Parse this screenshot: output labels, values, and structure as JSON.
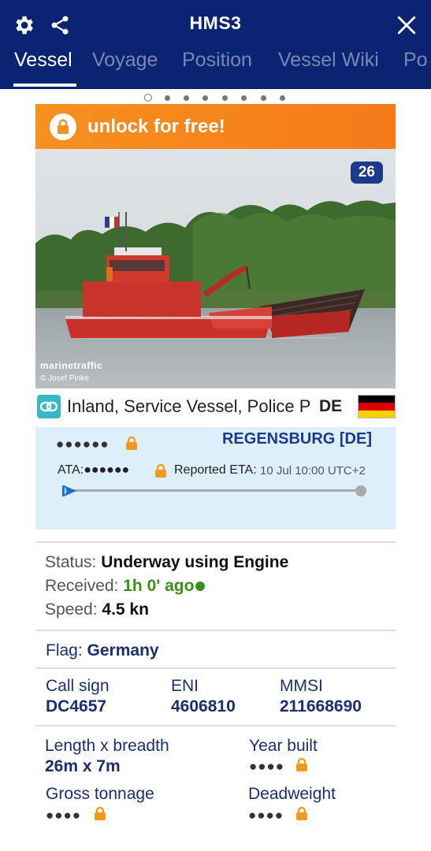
{
  "header": {
    "title": "HMS3",
    "icons": {
      "settings": "gear-icon",
      "share": "share-icon",
      "close": "close-icon"
    }
  },
  "tabs": [
    {
      "label": "Vessel",
      "active": true
    },
    {
      "label": "Voyage",
      "active": false
    },
    {
      "label": "Position",
      "active": false
    },
    {
      "label": "Vessel Wiki",
      "active": false
    },
    {
      "label": "Po",
      "active": false
    }
  ],
  "pager": {
    "pages": 8,
    "current": 1
  },
  "unlock": {
    "label": "unlock for free!"
  },
  "photo": {
    "count": "26",
    "watermark": "marinetraffic",
    "credit": "© Josef Pinke"
  },
  "vessel_type": {
    "text": "Inland, Service Vessel, Police Pa",
    "flag_code": "DE"
  },
  "voyage": {
    "origin_masked": "●●●●●●",
    "destination": "REGENSBURG [DE]",
    "ata_label": "ATA:",
    "ata_masked": "●●●●●●",
    "eta_label": "Reported ETA:",
    "eta_value": "10 Jul 10:00 UTC+2"
  },
  "status": {
    "status_label": "Status:",
    "status_value": "Underway using Engine",
    "received_label": "Received:",
    "received_value": "1h 0' ago",
    "speed_label": "Speed:",
    "speed_value": "4.5 kn"
  },
  "flag": {
    "label": "Flag:",
    "value": "Germany"
  },
  "ids": {
    "callsign_label": "Call sign",
    "callsign_value": "DC4657",
    "eni_label": "ENI",
    "eni_value": "4606810",
    "mmsi_label": "MMSI",
    "mmsi_value": "211668690"
  },
  "dimensions": {
    "length_label": "Length x breadth",
    "length_value": "26m x 7m",
    "year_label": "Year built",
    "year_masked": "●●●●",
    "gross_label": "Gross tonnage",
    "gross_masked": "●●●●",
    "deadweight_label": "Deadweight",
    "deadweight_masked": "●●●●"
  },
  "colors": {
    "header": "#0a2473",
    "unlock": "#f6901e",
    "accent": "#1b3a8a",
    "green": "#3a8e1a",
    "voyage_bg": "#ddeffb"
  }
}
